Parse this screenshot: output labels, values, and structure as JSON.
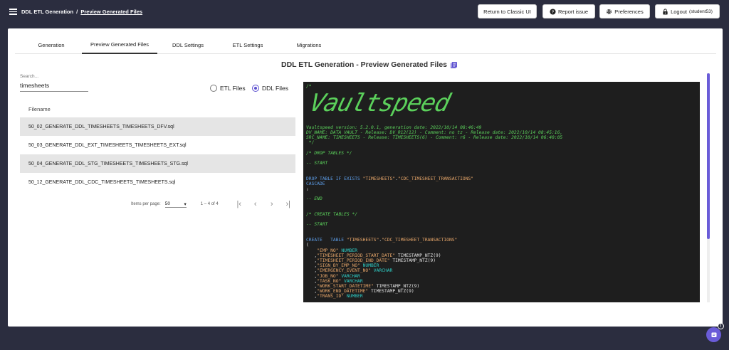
{
  "header": {
    "breadcrumb_root": "DDL ETL Generation",
    "breadcrumb_sep": "/",
    "breadcrumb_current": "Preview Generated Files",
    "classic_ui_label": "Return to Classic UI",
    "report_issue_label": "Report issue",
    "preferences_label": "Preferences",
    "logout_label": "Logout",
    "logout_user": "(student53)"
  },
  "tabs": [
    {
      "label": "Generation"
    },
    {
      "label": "Preview Generated Files"
    },
    {
      "label": "DDL Settings"
    },
    {
      "label": "ETL Settings"
    },
    {
      "label": "Migrations"
    }
  ],
  "page_title": "DDL ETL Generation - Preview Generated Files",
  "search": {
    "label": "Search...",
    "value": "timesheets"
  },
  "filter": {
    "etl_label": "ETL Files",
    "ddl_label": "DDL Files",
    "selected": "DDL Files"
  },
  "table": {
    "header": "Filename",
    "rows": [
      "50_02_GENERATE_DDL_TIMESHEETS_TIMESHEETS_DFV.sql",
      "50_03_GENERATE_DDL_EXT_TIMESHEETS_TIMESHEETS_EXT.sql",
      "50_04_GENERATE_DDL_STG_TIMESHEETS_TIMESHEETS_STG.sql",
      "50_12_GENERATE_DDL_CDC_TIMESHEETS_TIMESHEETS.sql"
    ]
  },
  "paginator": {
    "items_per_page_label": "Items per page:",
    "items_per_page_value": "50",
    "range": "1 – 4 of 4"
  },
  "code": {
    "ascii_banner": "Vaultspeed",
    "lines": [
      [
        {
          "c": "c",
          "t": "/*"
        }
      ],
      [
        {
          "c": "c",
          "t": ""
        }
      ],
      [
        {
          "c": "c",
          "t": ""
        }
      ],
      [
        {
          "c": "c",
          "t": ""
        }
      ],
      [
        {
          "c": "c",
          "t": ""
        }
      ],
      [
        {
          "c": "c",
          "t": ""
        }
      ],
      [
        {
          "c": "c",
          "t": ""
        }
      ],
      [
        {
          "c": "c",
          "t": ""
        }
      ],
      [
        {
          "c": "c",
          "t": "Vaultspeed version: 5.2.0.1, generation date: 2022/10/14 08:46:49"
        }
      ],
      [
        {
          "c": "c",
          "t": "DV_NAME: DATA VAULT - Release: DV_R12(12) - Comment: no tz - Release date: 2022/10/14 08:45:16,"
        }
      ],
      [
        {
          "c": "c",
          "t": "SRC_NAME: TIMESHEETS - Release: TIMESHEETS(6) - Comment: r6 - Release date: 2022/10/14 06:40:05"
        }
      ],
      [
        {
          "c": "c",
          "t": " */"
        }
      ],
      [
        {
          "c": "c",
          "t": ""
        }
      ],
      [
        {
          "c": "c",
          "t": "/* DROP TABLES */"
        }
      ],
      [
        {
          "c": "c",
          "t": ""
        }
      ],
      [
        {
          "c": "c",
          "t": "-- START"
        }
      ],
      [
        {
          "c": "c",
          "t": ""
        }
      ],
      [
        {
          "c": "c",
          "t": ""
        }
      ],
      [
        {
          "c": "k",
          "t": "DROP TABLE IF EXISTS "
        },
        {
          "c": "s",
          "t": "\"TIMESHEETS\""
        },
        {
          "c": "w",
          "t": "."
        },
        {
          "c": "s",
          "t": "\"CDC_TIMESHEET_TRANSACTIONS\""
        }
      ],
      [
        {
          "c": "k",
          "t": "CASCADE"
        }
      ],
      [
        {
          "c": "w",
          "t": ";"
        }
      ],
      [
        {
          "c": "c",
          "t": ""
        }
      ],
      [
        {
          "c": "c",
          "t": "-- END"
        }
      ],
      [
        {
          "c": "c",
          "t": ""
        }
      ],
      [
        {
          "c": "c",
          "t": ""
        }
      ],
      [
        {
          "c": "c",
          "t": "/* CREATE TABLES */"
        }
      ],
      [
        {
          "c": "c",
          "t": ""
        }
      ],
      [
        {
          "c": "c",
          "t": "-- START"
        }
      ],
      [
        {
          "c": "c",
          "t": ""
        }
      ],
      [
        {
          "c": "c",
          "t": ""
        }
      ],
      [
        {
          "c": "k",
          "t": "CREATE   TABLE "
        },
        {
          "c": "s",
          "t": "\"TIMESHEETS\""
        },
        {
          "c": "w",
          "t": "."
        },
        {
          "c": "s",
          "t": "\"CDC_TIMESHEET_TRANSACTIONS\""
        }
      ],
      [
        {
          "c": "w",
          "t": "("
        }
      ],
      [
        {
          "c": "w",
          "t": "    "
        },
        {
          "c": "s",
          "t": "\"EMP_NO\""
        },
        {
          "c": "w",
          "t": " "
        },
        {
          "c": "t",
          "t": "NUMBER"
        }
      ],
      [
        {
          "c": "w",
          "t": "   ,"
        },
        {
          "c": "s",
          "t": "\"TIMESHEET_PERIOD_START_DATE\""
        },
        {
          "c": "w",
          "t": " TIMESTAMP_NTZ(9)"
        }
      ],
      [
        {
          "c": "w",
          "t": "   ,"
        },
        {
          "c": "s",
          "t": "\"TIMESHEET_PERIOD_END_DATE\""
        },
        {
          "c": "w",
          "t": " TIMESTAMP_NTZ(9)"
        }
      ],
      [
        {
          "c": "w",
          "t": "   ,"
        },
        {
          "c": "s",
          "t": "\"SIGN_BY_EMP_NO\""
        },
        {
          "c": "w",
          "t": " "
        },
        {
          "c": "t",
          "t": "NUMBER"
        }
      ],
      [
        {
          "c": "w",
          "t": "   ,"
        },
        {
          "c": "s",
          "t": "\"EMERGENCY_EVENT_NO\""
        },
        {
          "c": "w",
          "t": " "
        },
        {
          "c": "t",
          "t": "VARCHAR"
        }
      ],
      [
        {
          "c": "w",
          "t": "   ,"
        },
        {
          "c": "s",
          "t": "\"JOB_NO\""
        },
        {
          "c": "w",
          "t": " "
        },
        {
          "c": "t",
          "t": "VARCHAR"
        }
      ],
      [
        {
          "c": "w",
          "t": "   ,"
        },
        {
          "c": "s",
          "t": "\"TASK_NO\""
        },
        {
          "c": "w",
          "t": " "
        },
        {
          "c": "t",
          "t": "VARCHAR"
        }
      ],
      [
        {
          "c": "w",
          "t": "   ,"
        },
        {
          "c": "s",
          "t": "\"WORK_START_DATETIME\""
        },
        {
          "c": "w",
          "t": " TIMESTAMP_NTZ(9)"
        }
      ],
      [
        {
          "c": "w",
          "t": "   ,"
        },
        {
          "c": "s",
          "t": "\"WORK_END_DATETIME\""
        },
        {
          "c": "w",
          "t": " TIMESTAMP_NTZ(9)"
        }
      ],
      [
        {
          "c": "w",
          "t": "   ,"
        },
        {
          "c": "s",
          "t": "\"TRANS_ID\""
        },
        {
          "c": "w",
          "t": " "
        },
        {
          "c": "t",
          "t": "NUMBER"
        }
      ]
    ]
  },
  "colors": {
    "accent": "#5b4fcf",
    "topbar": "#2b2d3f"
  }
}
